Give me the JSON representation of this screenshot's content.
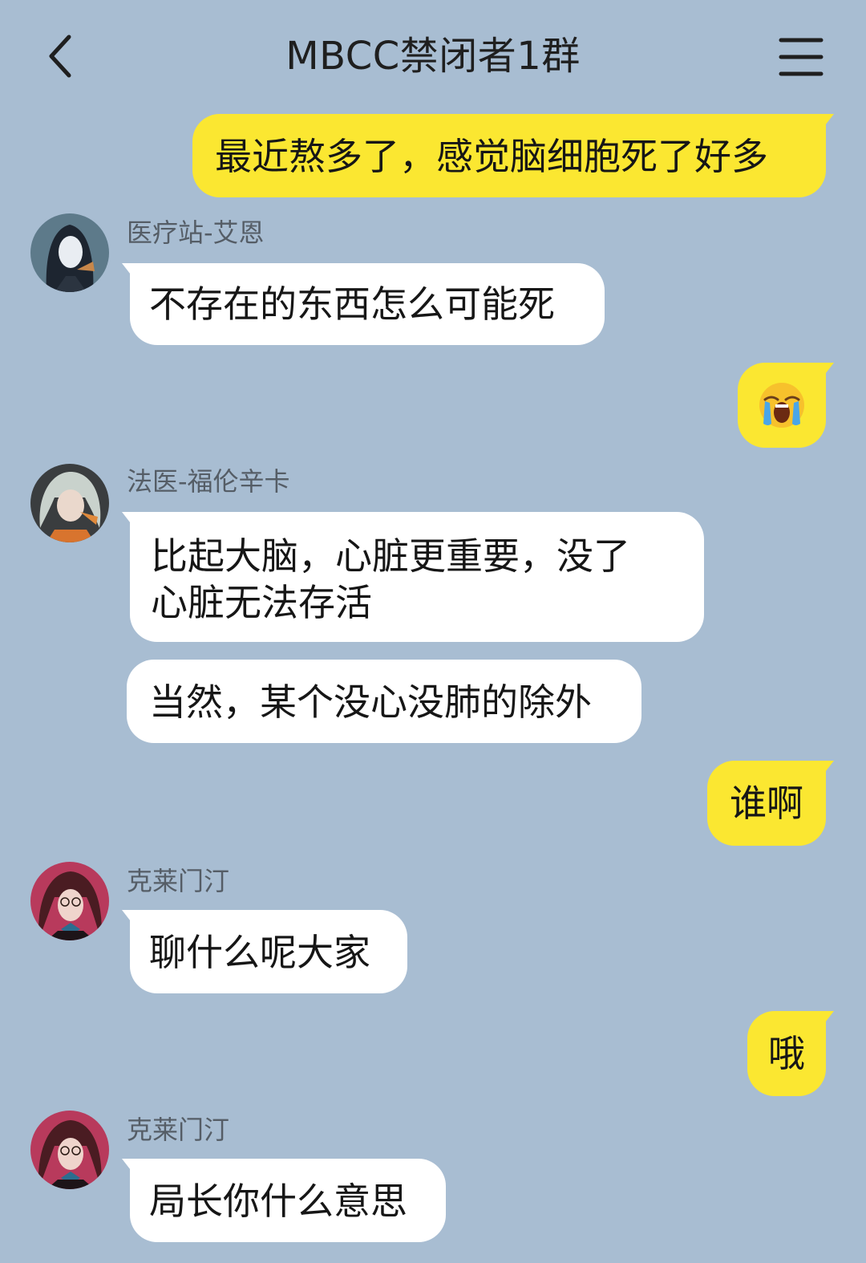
{
  "header": {
    "title": "MBCC禁闭者1群",
    "back_icon": "chevron-left-icon",
    "menu_icon": "hamburger-menu-icon"
  },
  "colors": {
    "background": "#a8bdd2",
    "outgoing_bubble": "#fbe731",
    "incoming_bubble": "#ffffff"
  },
  "messages": [
    {
      "side": "out",
      "text": "最近熬多了，感觉脑细胞死了好多"
    },
    {
      "side": "in",
      "sender": "医疗站-艾恩",
      "text": "不存在的东西怎么可能死"
    },
    {
      "side": "out",
      "emoji": "😭",
      "emoji_name": "loudly-crying-face-icon"
    },
    {
      "side": "in",
      "sender": "法医-福伦辛卡",
      "text_line1": "比起大脑，心脏更重要，没了",
      "text_line2": "心脏无法存活"
    },
    {
      "side": "in",
      "text": "当然，某个没心没肺的除外"
    },
    {
      "side": "out",
      "text": "谁啊"
    },
    {
      "side": "in",
      "sender": "克莱门汀",
      "text": "聊什么呢大家"
    },
    {
      "side": "out",
      "text": "哦"
    },
    {
      "side": "in",
      "sender": "克莱门汀",
      "text": "局长你什么意思"
    }
  ]
}
